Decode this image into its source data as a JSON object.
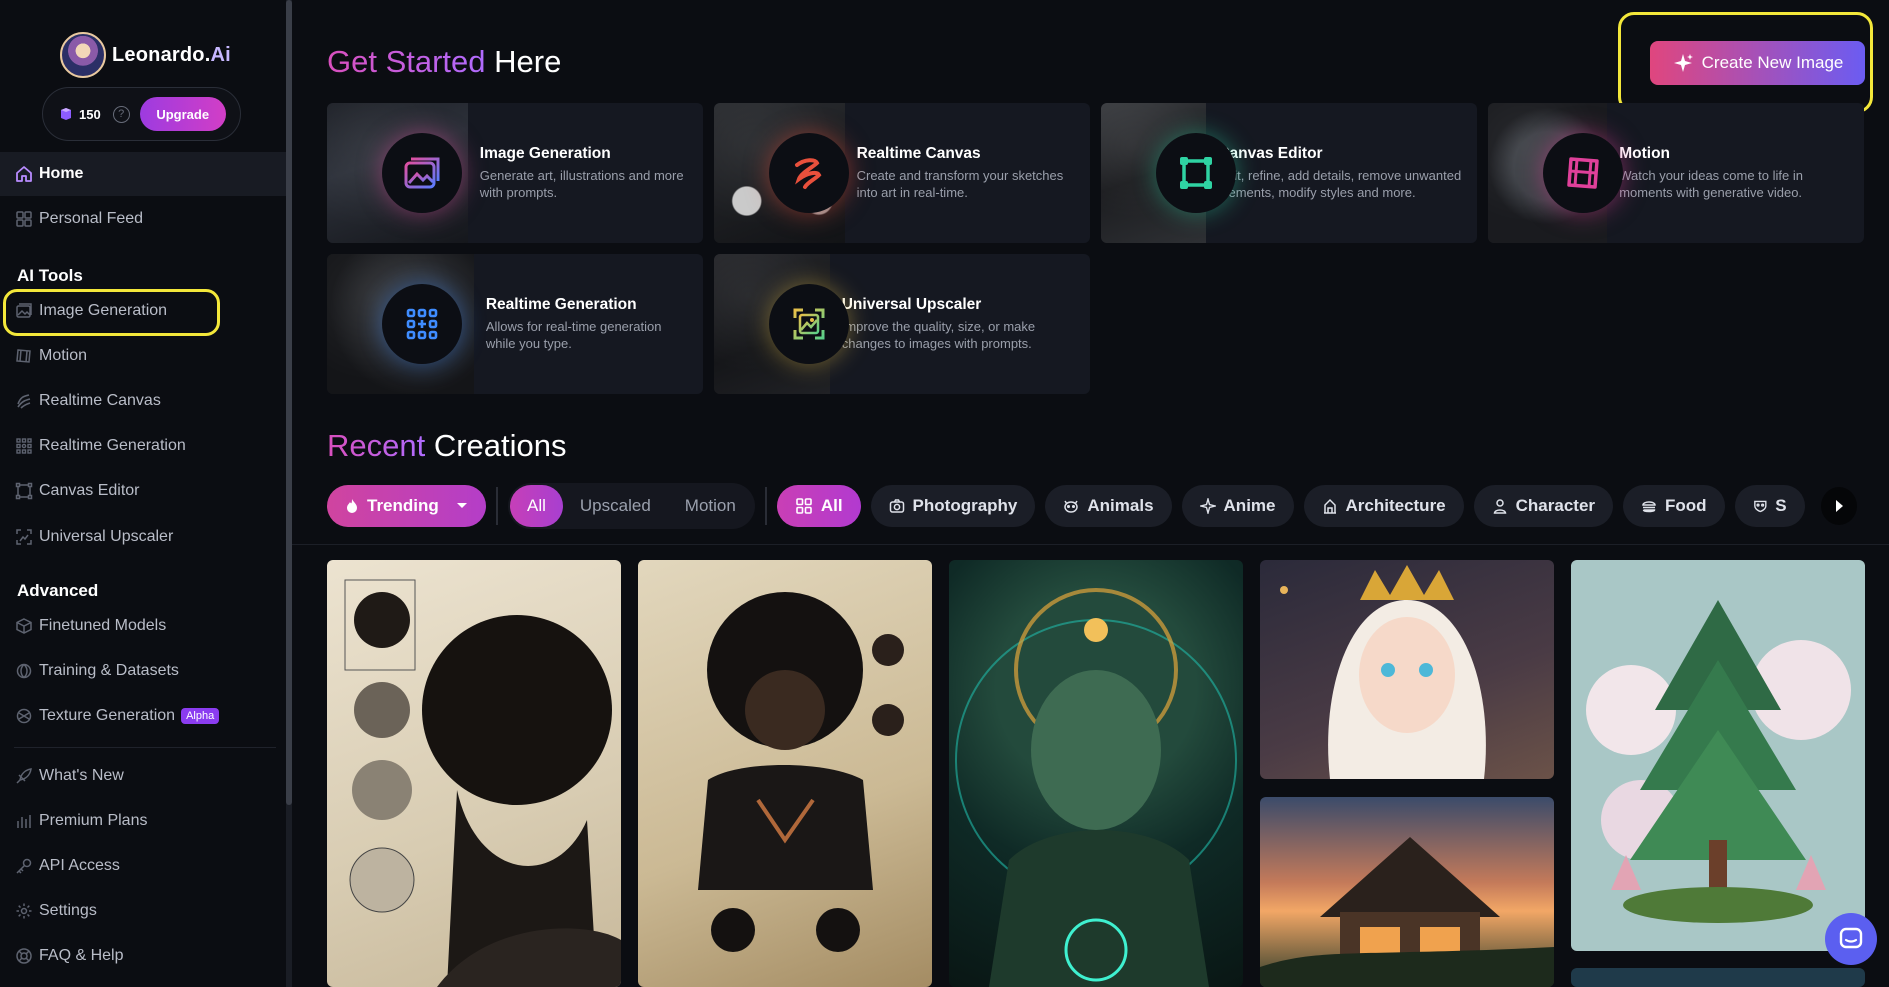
{
  "sidebar": {
    "brand": {
      "name": "Leonardo.",
      "name_suffix": "Ai"
    },
    "credits": {
      "count": "150",
      "help": "?",
      "upgrade_label": "Upgrade"
    },
    "nav_top": [
      {
        "label": "Home",
        "icon": "home-icon",
        "active": true
      },
      {
        "label": "Personal Feed",
        "icon": "grid-icon"
      }
    ],
    "section_ai_tools": "AI Tools",
    "ai_tools": [
      {
        "label": "Image Generation",
        "icon": "image-icon"
      },
      {
        "label": "Motion",
        "icon": "film-icon"
      },
      {
        "label": "Realtime Canvas",
        "icon": "brush-icon"
      },
      {
        "label": "Realtime Generation",
        "icon": "dots-grid-icon"
      },
      {
        "label": "Canvas Editor",
        "icon": "canvas-frame-icon"
      },
      {
        "label": "Universal Upscaler",
        "icon": "upscale-icon"
      }
    ],
    "section_advanced": "Advanced",
    "advanced": [
      {
        "label": "Finetuned Models",
        "icon": "cube-icon"
      },
      {
        "label": "Training & Datasets",
        "icon": "training-icon"
      },
      {
        "label": "Texture Generation",
        "icon": "texture-icon",
        "badge": "Alpha"
      }
    ],
    "bottom": [
      {
        "label": "What's New",
        "icon": "rocket-icon"
      },
      {
        "label": "Premium Plans",
        "icon": "plans-icon"
      },
      {
        "label": "API Access",
        "icon": "key-icon"
      },
      {
        "label": "Settings",
        "icon": "gear-icon"
      },
      {
        "label": "FAQ & Help",
        "icon": "help-circle-icon"
      }
    ]
  },
  "main": {
    "get_started": {
      "accent": "Get Started",
      "rest": " Here"
    },
    "create_button": "Create New Image",
    "tools": [
      {
        "title": "Image Generation",
        "desc": "Generate art, illustrations and more with prompts.",
        "icon": "image-gen-icon",
        "color": "#e04fa0"
      },
      {
        "title": "Realtime Canvas",
        "desc": "Create and transform your sketches into art in real-time.",
        "icon": "squiggle-icon",
        "color": "#e8503c"
      },
      {
        "title": "Canvas Editor",
        "desc": "Edit, refine, add details, remove unwanted elements, modify styles and more.",
        "icon": "frame-icon",
        "color": "#2fd3a3"
      },
      {
        "title": "Motion",
        "desc": "Watch your ideas come to life in moments with generative video.",
        "icon": "film-icon",
        "color": "#e0409a"
      },
      {
        "title": "Realtime Generation",
        "desc": "Allows for real-time generation while you type.",
        "icon": "dots-grid-icon",
        "color": "#3f8cff"
      },
      {
        "title": "Universal Upscaler",
        "desc": "Improve the quality, size, or make changes to images with prompts.",
        "icon": "upscale-icon",
        "color": "#e8c04a"
      }
    ],
    "recent": {
      "accent": "Recent",
      "rest": " Creations"
    },
    "filters": {
      "trending": "Trending",
      "type_tabs": [
        "All",
        "Upscaled",
        "Motion"
      ],
      "categories": [
        "All",
        "Photography",
        "Animals",
        "Anime",
        "Architecture",
        "Character",
        "Food",
        "S"
      ]
    }
  }
}
